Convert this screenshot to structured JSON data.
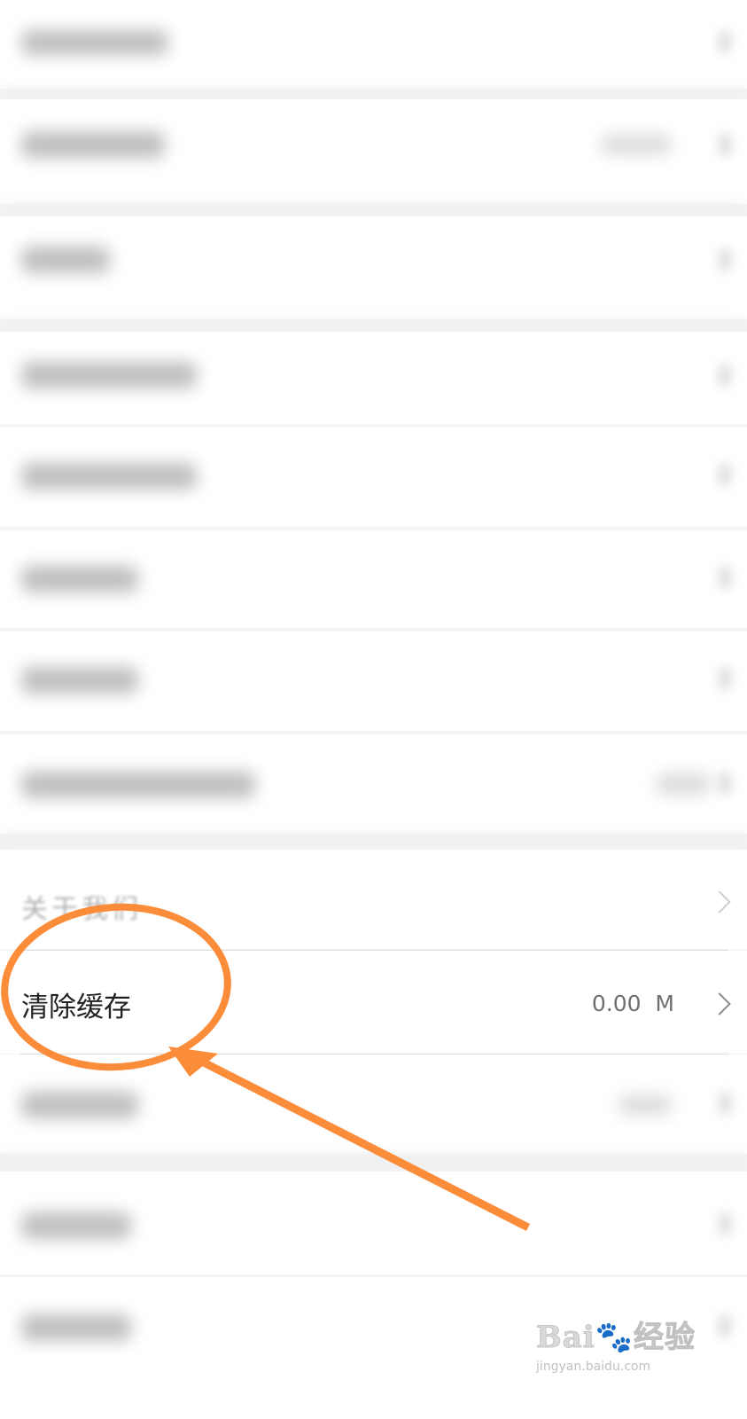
{
  "settings": {
    "about_label": "关于我们",
    "clear_cache": {
      "label": "清除缓存",
      "value": "0.00  M"
    }
  },
  "colors": {
    "annotation": "#fb8c3a",
    "background": "#f5f5f5",
    "row": "#ffffff"
  },
  "icons": {
    "row_chevron": "chevron-right-icon"
  },
  "watermark": {
    "brand": "Bai🐾经验",
    "url": "jingyan.baidu.com"
  }
}
